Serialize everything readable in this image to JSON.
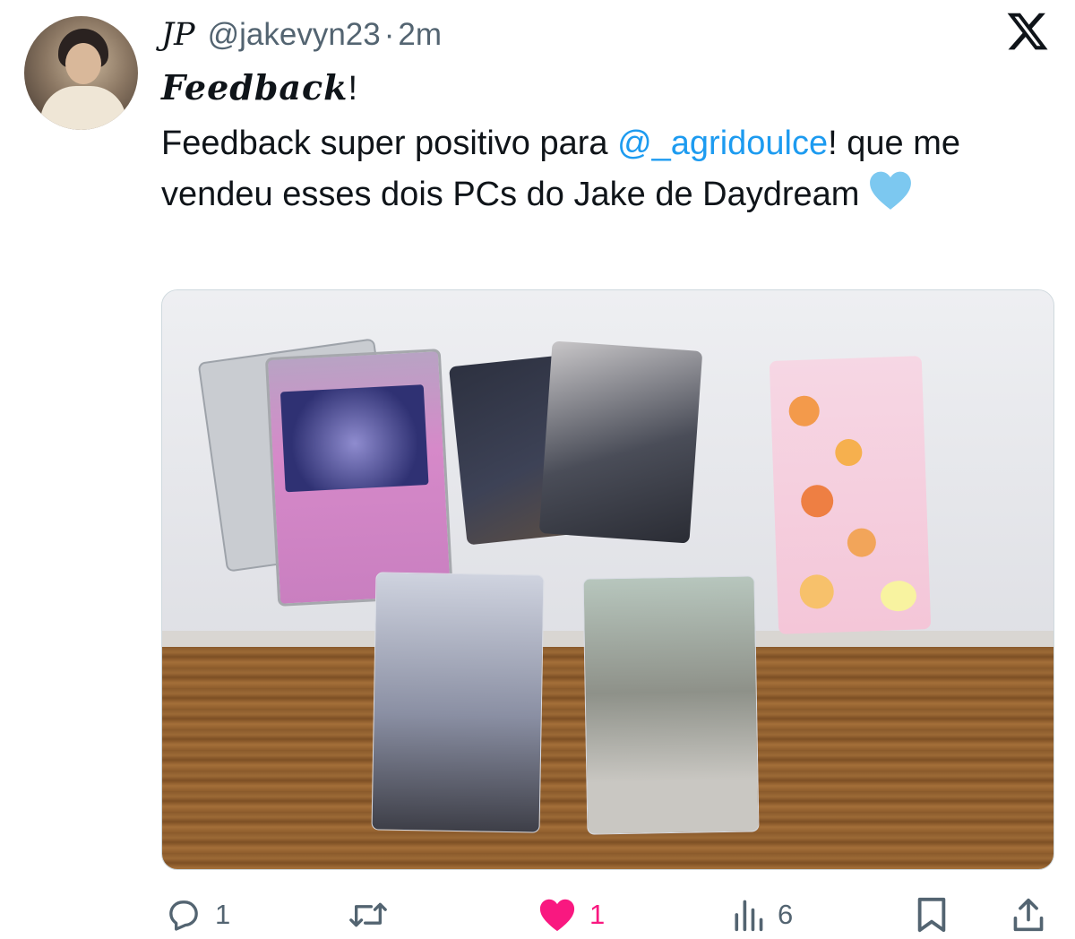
{
  "tweet": {
    "display_name": "JP",
    "handle": "@jakevyn23",
    "time": "2m",
    "title_fancy": "Feedback",
    "title_punct": "!",
    "body": {
      "text_before": "Feedback super positivo para ",
      "mention": "@_agridoulce",
      "text_after": "! que me vendeu esses dois PCs do Jake de Daydream",
      "emoji": "light-blue-heart-emoji"
    }
  },
  "actions": {
    "reply": {
      "icon": "reply-icon",
      "count": "1"
    },
    "retweet": {
      "icon": "retweet-icon",
      "count": ""
    },
    "like": {
      "icon": "heart-icon",
      "count": "1",
      "liked": true
    },
    "views": {
      "icon": "views-icon",
      "count": "6"
    },
    "bookmark": {
      "icon": "bookmark-icon"
    },
    "share": {
      "icon": "share-icon"
    }
  },
  "colors": {
    "text": "#0f1419",
    "secondary": "#536471",
    "link": "#1d9bf0",
    "like": "#f91880"
  }
}
